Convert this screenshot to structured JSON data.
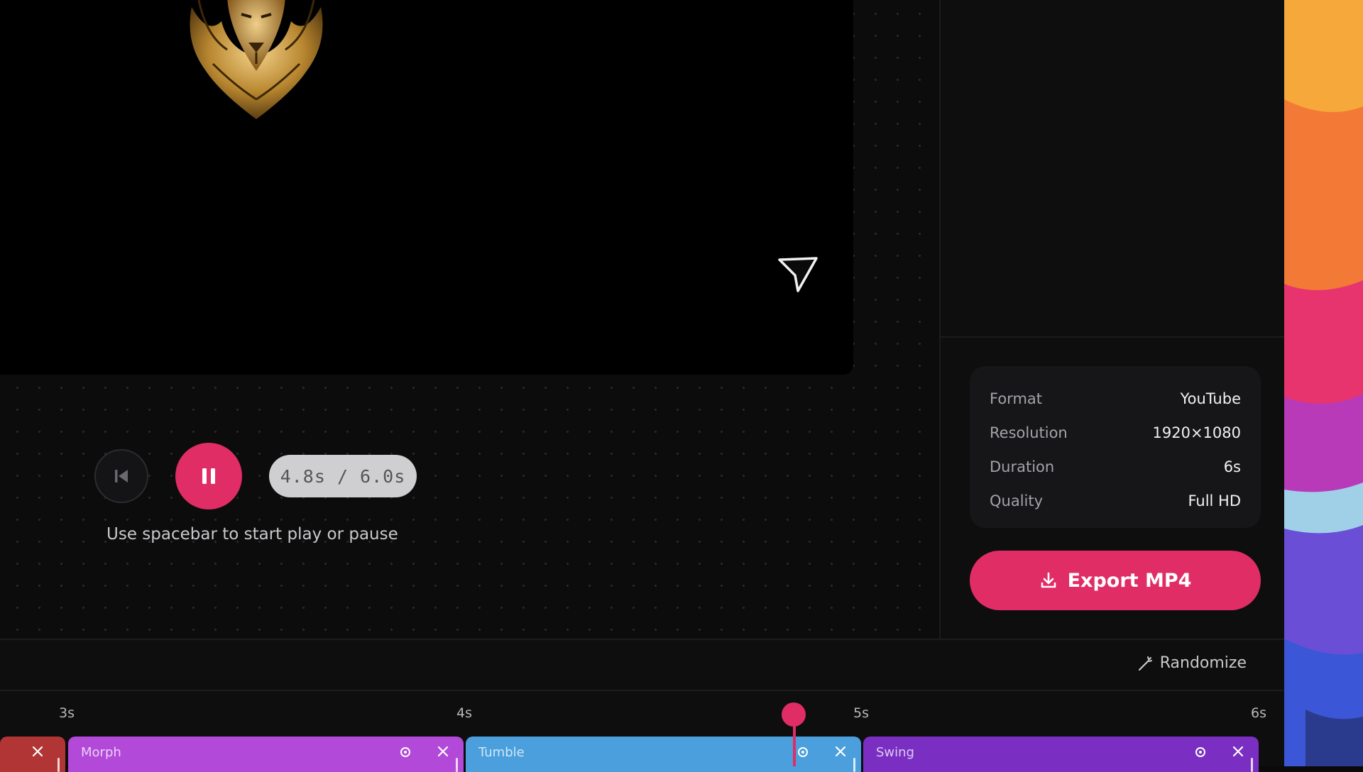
{
  "player": {
    "time_display": "4.8s / 6.0s",
    "hint": "Use spacebar to start play or pause"
  },
  "export_info": {
    "rows": [
      {
        "key": "Format",
        "value": "YouTube"
      },
      {
        "key": "Resolution",
        "value": "1920×1080"
      },
      {
        "key": "Duration",
        "value": "6s"
      },
      {
        "key": "Quality",
        "value": "Full HD"
      }
    ],
    "export_label": "Export MP4"
  },
  "timeline": {
    "randomize_label": "Randomize",
    "ticks": [
      "3s",
      "4s",
      "5s",
      "6s"
    ],
    "playhead_seconds": 4.8,
    "clips": [
      {
        "label": "",
        "color": "#b23535"
      },
      {
        "label": "Morph",
        "color": "#b249d9"
      },
      {
        "label": "Tumble",
        "color": "#4a9fdc"
      },
      {
        "label": "Swing",
        "color": "#7a2fc2"
      }
    ]
  },
  "colors": {
    "accent": "#e02d65",
    "background": "#0b0b0c"
  },
  "icons": [
    "lion-logo-icon",
    "send-cursor-icon",
    "skip-back-icon",
    "pause-icon",
    "download-icon",
    "wand-icon",
    "settings-icon",
    "close-icon"
  ]
}
